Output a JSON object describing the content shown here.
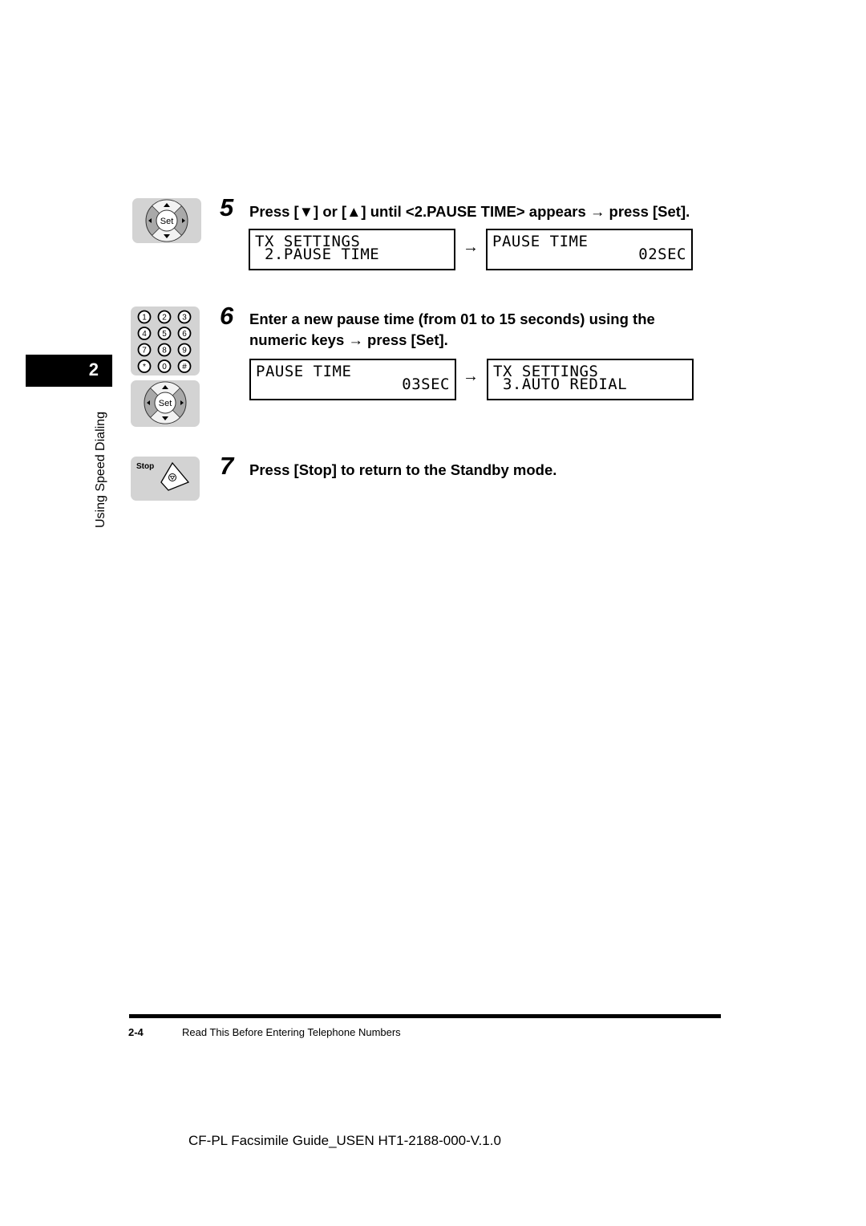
{
  "chapter": {
    "number": "2",
    "title": "Using Speed Dialing"
  },
  "steps": [
    {
      "number": "5",
      "text_lines": [
        "Press [▼] or [▲] until <2.PAUSE TIME> appears → press [Set]."
      ],
      "key_panel": "arrow-set-keys",
      "displays": [
        {
          "line1": "TX SETTINGS",
          "line2": " 2.PAUSE TIME",
          "line2_align": "left"
        },
        {
          "line1": "PAUSE TIME",
          "line2": "02SEC",
          "line2_align": "right"
        }
      ],
      "arrow": "→"
    },
    {
      "number": "6",
      "text_lines": [
        "Enter a new pause time (from 01 to 15 seconds) using the",
        "numeric keys → press [Set]."
      ],
      "key_panel": "numeric-keypad",
      "displays": [
        {
          "line1": "PAUSE TIME",
          "line2": "03SEC",
          "line2_align": "right"
        },
        {
          "line1": "TX SETTINGS",
          "line2": " 3.AUTO REDIAL",
          "line2_align": "left"
        }
      ],
      "arrow": "→"
    },
    {
      "number": "7",
      "text_lines": [
        "Press [Stop] to return to the Standby mode."
      ],
      "key_panel": "stop-key"
    }
  ],
  "keys": {
    "set_label": "Set",
    "stop_label": "Stop",
    "numeric": [
      "1",
      "2",
      "3",
      "4",
      "5",
      "6",
      "7",
      "8",
      "9",
      "*",
      "0",
      "#"
    ]
  },
  "footer": {
    "page_number": "2-4",
    "section_title": "Read This Before Entering Telephone Numbers",
    "document_id": "CF-PL Facsimile Guide_USEN HT1-2188-000-V.1.0"
  }
}
